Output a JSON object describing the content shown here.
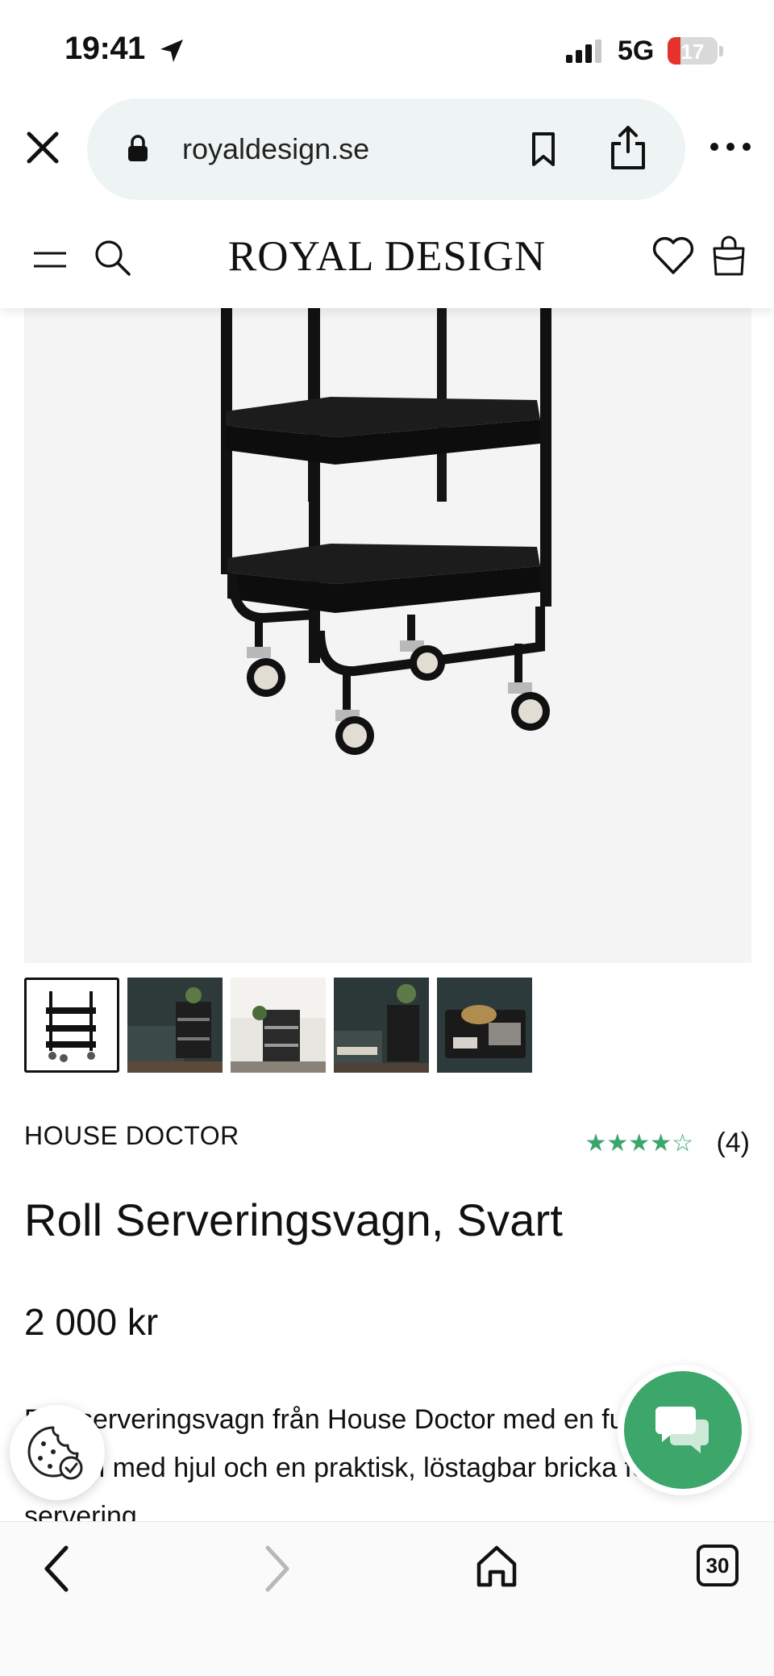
{
  "status_bar": {
    "time": "19:41",
    "network": "5G",
    "battery_level": "17",
    "battery_fraction": 0.17
  },
  "browser": {
    "url": "royaldesign.se",
    "tab_count": "30"
  },
  "header": {
    "logo": "ROYAL DESIGN"
  },
  "gallery": {
    "thumbnail_count": 5,
    "active_index": 0
  },
  "product": {
    "brand": "HOUSE DOCTOR",
    "rating_stars": "★★★★☆",
    "rating_value": 4,
    "rating_count": "(4)",
    "title": "Roll Serveringsvagn, Svart",
    "price": "2 000 kr",
    "description": "Roll serveringsvagn från House Doctor med en funktionell design med hjul och en praktisk, löstagbar bricka för servering."
  },
  "colors": {
    "accent_green": "#3da66b",
    "star_green": "#3aa66e",
    "url_bar_bg": "#eef4f4",
    "image_bg": "#f4f4f4"
  },
  "icons": {
    "close": "close-icon",
    "lock": "lock-icon",
    "bookmark": "bookmark-icon",
    "share": "share-icon",
    "more": "more-icon",
    "menu": "menu-icon",
    "search": "search-icon",
    "wishlist": "heart-icon",
    "cart": "shopping-bag-icon",
    "cookie": "cookie-icon",
    "chat": "chat-icon",
    "back": "chevron-left-icon",
    "forward": "chevron-right-icon",
    "home": "home-icon"
  }
}
